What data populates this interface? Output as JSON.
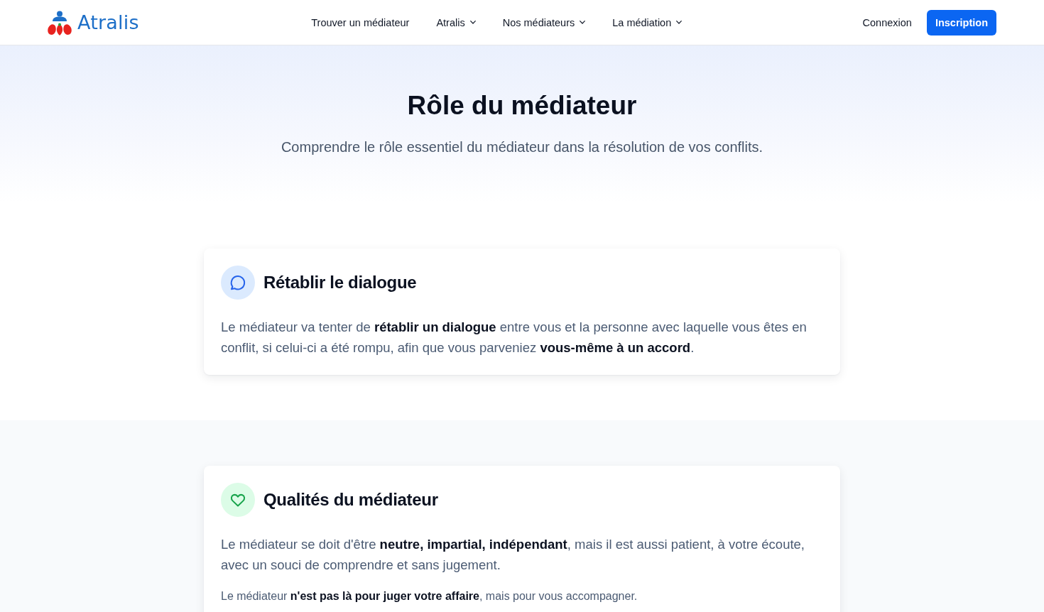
{
  "header": {
    "logo": {
      "text": "Atralis"
    },
    "nav": [
      {
        "label": "Trouver un médiateur",
        "dropdown": false
      },
      {
        "label": "Atralis",
        "dropdown": true
      },
      {
        "label": "Nos médiateurs",
        "dropdown": true
      },
      {
        "label": "La médiation",
        "dropdown": true
      }
    ],
    "login": "Connexion",
    "signup": "Inscription"
  },
  "hero": {
    "title": "Rôle du médiateur",
    "subtitle": "Comprendre le rôle essentiel du médiateur dans la résolution de vos conflits."
  },
  "sections": [
    {
      "card": {
        "kind": "chat",
        "title": "Rétablir le dialogue",
        "paragraphs": [
          {
            "kind": "lead",
            "text": "Le médiateur va tenter de **rétablir un dialogue** entre vous et la personne avec laquelle vous êtes en conflit, si celui-ci a été rompu, afin que vous parveniez **vous-même à un accord**."
          }
        ]
      }
    },
    {
      "card": {
        "kind": "heart",
        "title": "Qualités du médiateur",
        "paragraphs": [
          {
            "kind": "lead",
            "text": "Le médiateur se doit d'être **neutre, impartial, indépendant**, mais il est aussi patient, à votre écoute, avec un souci de comprendre et sans jugement."
          },
          {
            "kind": "note",
            "text": "Le médiateur **n'est pas là pour juger votre affaire**, mais pour vous accompagner."
          }
        ]
      }
    }
  ]
}
